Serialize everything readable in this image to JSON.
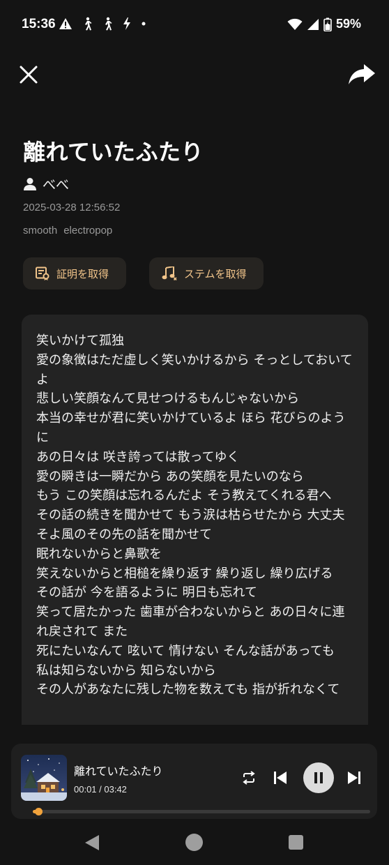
{
  "status_bar": {
    "time": "15:36",
    "battery_percent": "59%",
    "left_icons": [
      "alert-icon",
      "walking-icon",
      "walking-icon",
      "bolt-icon",
      "dot-icon"
    ],
    "right_icons": [
      "wifi-icon",
      "signal-icon",
      "battery-charging-icon"
    ]
  },
  "header": {
    "close_icon": "close-icon",
    "share_icon": "share-icon"
  },
  "song": {
    "title": "離れていたふたり",
    "artist": "べべ",
    "date": "2025-03-28 12:56:52",
    "tags": [
      "smooth",
      "electropop"
    ]
  },
  "actions": {
    "certificate_label": "証明を取得",
    "stems_label": "ステムを取得",
    "accent_color": "#f1c48a"
  },
  "lyrics": {
    "lines": [
      "笑いかけて孤独",
      "愛の象徴はただ虚しく笑いかけるから そっとしておいてよ",
      "悲しい笑顔なんて見せつけるもんじゃないから",
      "本当の幸せが君に笑いかけているよ ほら 花びらのように",
      "あの日々は 咲き誇っては散ってゆく",
      "愛の瞬きは一瞬だから あの笑顔を見たいのなら",
      "もう この笑顔は忘れるんだよ そう教えてくれる君へ",
      "その話の続きを聞かせて もう涙は枯らせたから 大丈夫",
      "そよ風のその先の話を聞かせて",
      "眠れないからと鼻歌を",
      "笑えないからと相槌を繰り返す 繰り返し 繰り広げる",
      "その話が 今を語るように 明日も忘れて",
      "笑って居たかった 歯車が合わないからと あの日々に連れ戻されて また",
      "死にたいなんて 呟いて 情けない そんな話があっても",
      "私は知らないから 知らないから",
      "その人があなたに残した物を数えても 指が折れなくて"
    ]
  },
  "player": {
    "title": "離れていたふたり",
    "time": "00:01 / 03:42",
    "progress_fraction": 0.005,
    "accent_color": "#f0a23c"
  },
  "nav": {
    "icons": [
      "back-icon",
      "home-icon",
      "recents-icon"
    ]
  }
}
